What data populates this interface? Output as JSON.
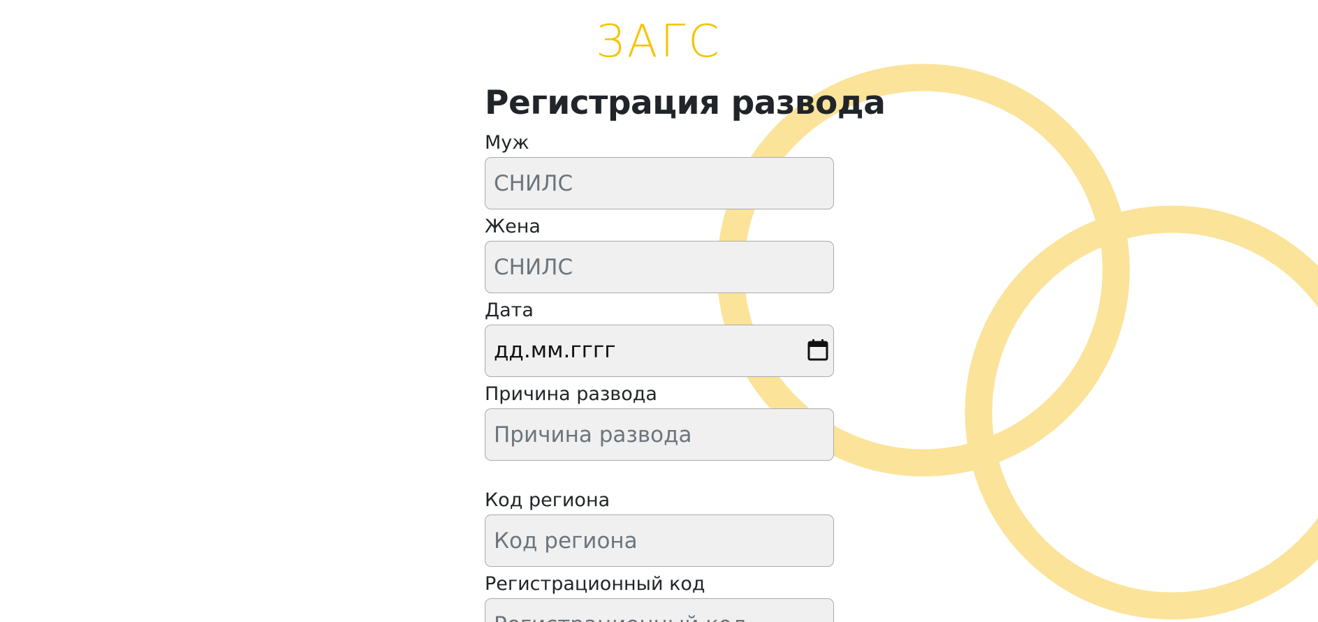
{
  "brand": {
    "logo_text": "ЗАГС",
    "accent_color": "#f5c400",
    "ring_color": "#fbe39a"
  },
  "form": {
    "title": "Регистрация развода",
    "fields": [
      {
        "label": "Муж",
        "placeholder": "СНИЛС",
        "value": ""
      },
      {
        "label": "Жена",
        "placeholder": "СНИЛС",
        "value": ""
      },
      {
        "label": "Дата",
        "placeholder": "дд.мм.гггг",
        "value": "",
        "icon": "calendar-icon"
      },
      {
        "label": "Причина развода",
        "placeholder": "Причина развода",
        "value": ""
      },
      {
        "label": "Код региона",
        "placeholder": "Код региона",
        "value": ""
      },
      {
        "label": "Регистрационный код",
        "placeholder": "Регистрационный код",
        "value": ""
      }
    ]
  }
}
